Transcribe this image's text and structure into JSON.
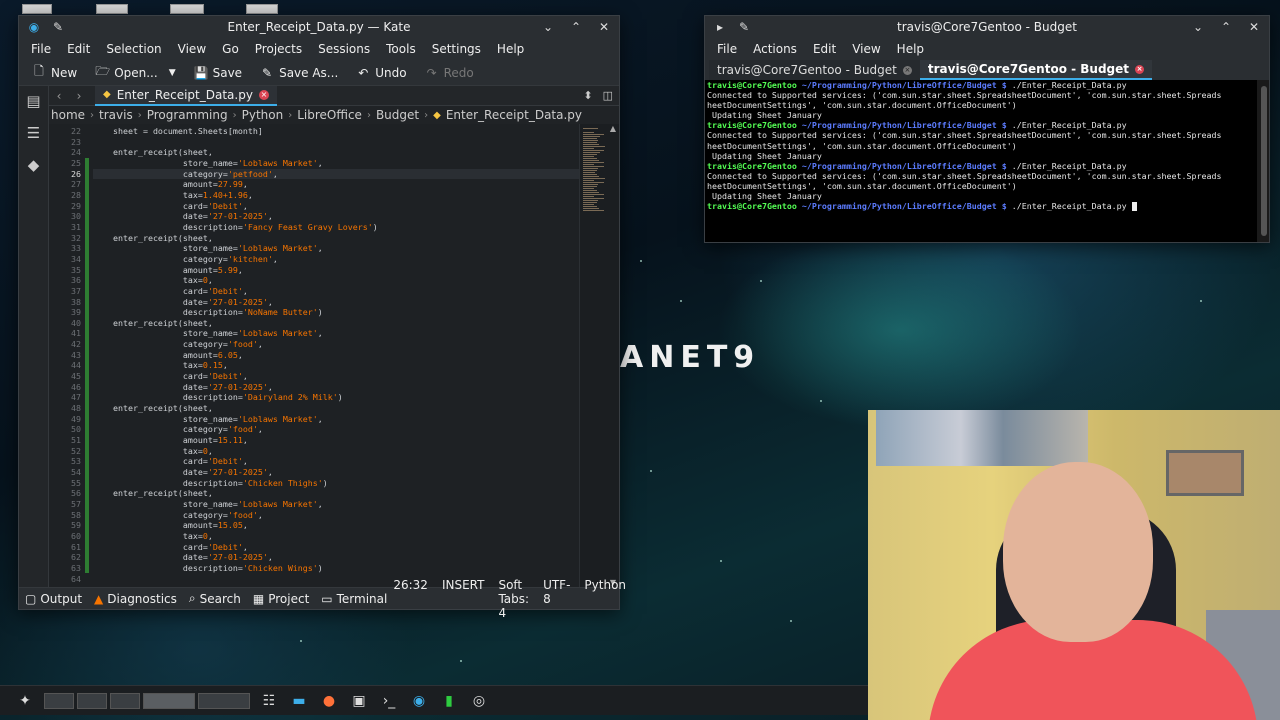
{
  "wallpaper_logo": "ANET9",
  "kate": {
    "title": "Enter_Receipt_Data.py — Kate",
    "menu": [
      "File",
      "Edit",
      "Selection",
      "View",
      "Go",
      "Projects",
      "Sessions",
      "Tools",
      "Settings",
      "Help"
    ],
    "toolbar": {
      "new": "New",
      "open": "Open...",
      "save": "Save",
      "save_as": "Save As...",
      "undo": "Undo",
      "redo": "Redo"
    },
    "tab_label": "Enter_Receipt_Data.py",
    "breadcrumb": [
      "home",
      "travis",
      "Programming",
      "Python",
      "LibreOffice",
      "Budget",
      "Enter_Receipt_Data.py"
    ],
    "line_numbers": [
      "22",
      "23",
      "24",
      "25",
      "26",
      "27",
      "28",
      "29",
      "30",
      "31",
      "32",
      "33",
      "34",
      "35",
      "36",
      "37",
      "38",
      "39",
      "40",
      "41",
      "42",
      "43",
      "44",
      "45",
      "46",
      "47",
      "48",
      "49",
      "50",
      "51",
      "52",
      "53",
      "54",
      "55",
      "56",
      "57",
      "58",
      "59",
      "60",
      "61",
      "62",
      "63",
      "64"
    ],
    "code_lines": [
      "    sheet = document.Sheets[month]",
      "",
      "    enter_receipt(sheet,",
      "                  store_name='Loblaws Market',",
      "                  category='petfood',",
      "                  amount=27.99,",
      "                  tax=1.40+1.96,",
      "                  card='Debit',",
      "                  date='27-01-2025',",
      "                  description='Fancy Feast Gravy Lovers')",
      "    enter_receipt(sheet,",
      "                  store_name='Loblaws Market',",
      "                  category='kitchen',",
      "                  amount=5.99,",
      "                  tax=0,",
      "                  card='Debit',",
      "                  date='27-01-2025',",
      "                  description='NoName Butter')",
      "    enter_receipt(sheet,",
      "                  store_name='Loblaws Market',",
      "                  category='food',",
      "                  amount=6.05,",
      "                  tax=0.15,",
      "                  card='Debit',",
      "                  date='27-01-2025',",
      "                  description='Dairyland 2% Milk')",
      "    enter_receipt(sheet,",
      "                  store_name='Loblaws Market',",
      "                  category='food',",
      "                  amount=15.11,",
      "                  tax=0,",
      "                  card='Debit',",
      "                  date='27-01-2025',",
      "                  description='Chicken Thighs')",
      "    enter_receipt(sheet,",
      "                  store_name='Loblaws Market',",
      "                  category='food',",
      "                  amount=15.05,",
      "                  tax=0,",
      "                  card='Debit',",
      "                  date='27-01-2025',",
      "                  description='Chicken Wings')",
      ""
    ],
    "current_line": "26",
    "status_left": {
      "output": "Output",
      "diagnostics": "Diagnostics",
      "search": "Search",
      "project": "Project",
      "terminal": "Terminal"
    },
    "status_right": {
      "position": "26:32",
      "mode": "INSERT",
      "indent": "Soft Tabs: 4",
      "encoding": "UTF-8",
      "language": "Python"
    }
  },
  "konsole": {
    "title": "travis@Core7Gentoo - Budget",
    "menu": [
      "File",
      "Actions",
      "Edit",
      "View",
      "Help"
    ],
    "tabs": [
      "travis@Core7Gentoo - Budget",
      "travis@Core7Gentoo - Budget"
    ],
    "prompt_user": "travis@Core7Gentoo",
    "prompt_path": "~/Programming/Python/LibreOffice/Budget $",
    "command": "./Enter_Receipt_Data.py",
    "output_1": "Connected to Supported services: ('com.sun.star.sheet.SpreadsheetDocument', 'com.sun.star.sheet.Spreads",
    "output_2": "heetDocumentSettings', 'com.sun.star.document.OfficeDocument')",
    "output_3": " Updating Sheet January"
  },
  "colors": {
    "accent": "#3daee9",
    "close": "#da4453",
    "string": "#f67400",
    "prompt_user": "#54ff54",
    "prompt_path": "#5c7cff"
  }
}
